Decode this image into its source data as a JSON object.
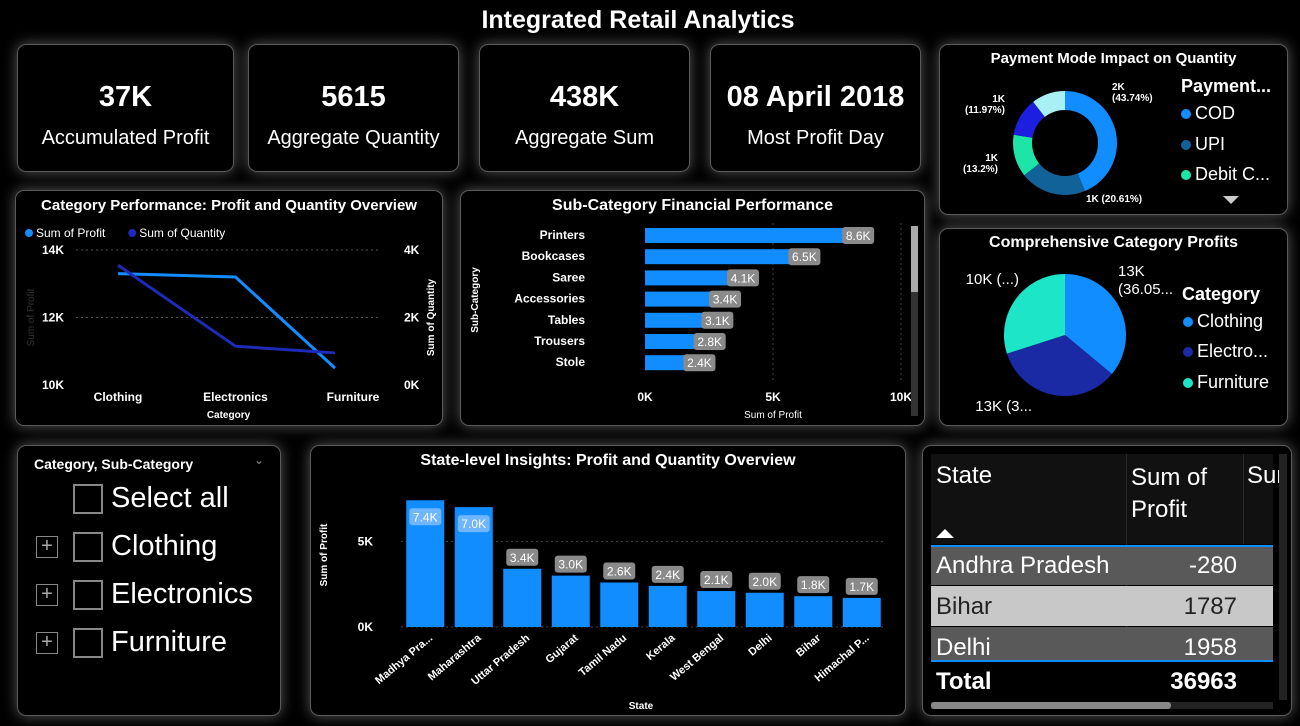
{
  "title": "Integrated Retail Analytics",
  "kpis": [
    {
      "value": "37K",
      "label": "Accumulated Profit"
    },
    {
      "value": "5615",
      "label": "Aggregate Quantity"
    },
    {
      "value": "438K",
      "label": "Aggregate Sum"
    },
    {
      "value": "08 April 2018",
      "label": "Most Profit Day"
    }
  ],
  "payment": {
    "title": "Payment Mode Impact on Quantity",
    "legend_title": "Payment...",
    "legend": [
      {
        "label": "COD",
        "color": "#118dff"
      },
      {
        "label": "UPI",
        "color": "#12629a"
      },
      {
        "label": "Debit C...",
        "color": "#1de5a8"
      }
    ]
  },
  "category_line": {
    "title": "Category Performance: Profit and Quantity Overview",
    "legend": [
      {
        "label": "Sum of Profit",
        "color": "#118dff"
      },
      {
        "label": "Sum of Quantity",
        "color": "#1e2bb8"
      }
    ]
  },
  "subcategory_bar": {
    "title": "Sub-Category Financial Performance"
  },
  "category_pie": {
    "title": "Comprehensive Category Profits",
    "legend_title": "Category",
    "legend": [
      {
        "label": "Clothing",
        "color": "#118dff"
      },
      {
        "label": "Electro...",
        "color": "#1a2aa5"
      },
      {
        "label": "Furniture",
        "color": "#1de5c8"
      }
    ]
  },
  "slicer": {
    "title": "Category, Sub-Category",
    "items": [
      "Select all",
      "Clothing",
      "Electronics",
      "Furniture"
    ]
  },
  "state_bar": {
    "title": "State-level Insights: Profit and Quantity Overview"
  },
  "table": {
    "headers": [
      "State",
      "Sum of Profit",
      "Sur"
    ],
    "rows": [
      {
        "state": "Andhra Pradesh",
        "profit": "-280"
      },
      {
        "state": "Bihar",
        "profit": "1787"
      },
      {
        "state": "Delhi",
        "profit": "1958"
      }
    ],
    "total_label": "Total",
    "total_value": "36963"
  },
  "chart_data": [
    {
      "type": "line",
      "title": "Category Performance: Profit and Quantity Overview",
      "xlabel": "Category",
      "ylabel": "Sum of Profit",
      "y2label": "Sum of Quantity",
      "categories": [
        "Clothing",
        "Electronics",
        "Furniture"
      ],
      "y_ticks": [
        "10K",
        "12K",
        "14K"
      ],
      "y2_ticks": [
        "0K",
        "2K",
        "4K"
      ],
      "ylim": [
        10000,
        14000
      ],
      "y2lim": [
        0,
        4000
      ],
      "series": [
        {
          "name": "Sum of Profit",
          "axis": "left",
          "values": [
            13300,
            13200,
            10500
          ],
          "color": "#118dff"
        },
        {
          "name": "Sum of Quantity",
          "axis": "right",
          "values": [
            3550,
            1150,
            950
          ],
          "color": "#1e2bb8"
        }
      ]
    },
    {
      "type": "bar",
      "orientation": "horizontal",
      "title": "Sub-Category Financial Performance",
      "xlabel": "Sum of Profit",
      "ylabel": "Sub-Category",
      "categories": [
        "Printers",
        "Bookcases",
        "Saree",
        "Accessories",
        "Tables",
        "Trousers",
        "Stole"
      ],
      "values": [
        8600,
        6500,
        4100,
        3400,
        3100,
        2800,
        2400
      ],
      "labels": [
        "8.6K",
        "6.5K",
        "4.1K",
        "3.4K",
        "3.1K",
        "2.8K",
        "2.4K"
      ],
      "x_ticks": [
        "0K",
        "5K",
        "10K"
      ],
      "xlim": [
        0,
        10000
      ],
      "color": "#118dff"
    },
    {
      "type": "pie",
      "subtype": "donut",
      "title": "Payment Mode Impact on Quantity",
      "slices": [
        {
          "label": "2K\n(43.74%)",
          "value": 43.74,
          "color": "#118dff"
        },
        {
          "label": "1K (20.61%)",
          "value": 20.61,
          "color": "#12629a"
        },
        {
          "label": "1K\n(13.2%)",
          "value": 13.2,
          "color": "#1de5a8"
        },
        {
          "label": "1K\n(11.97%)",
          "value": 11.97,
          "color": "#1c1fe0"
        },
        {
          "value": 10.48,
          "color": "#a9f0f5"
        }
      ]
    },
    {
      "type": "pie",
      "title": "Comprehensive Category Profits",
      "slices": [
        {
          "label": "13K\n(36.05...",
          "value": 36.05,
          "color": "#118dff"
        },
        {
          "label": "13K (3...",
          "value": 34.0,
          "color": "#1a2aa5"
        },
        {
          "label": "10K (...)",
          "value": 29.95,
          "color": "#1de5c8"
        }
      ]
    },
    {
      "type": "bar",
      "title": "State-level Insights: Profit and Quantity Overview",
      "xlabel": "State",
      "ylabel": "Sum of Profit",
      "categories": [
        "Madhya Pra...",
        "Maharashtra",
        "Uttar Pradesh",
        "Gujarat",
        "Tamil Nadu",
        "Kerala",
        "West Bengal",
        "Delhi",
        "Bihar",
        "Himachal P..."
      ],
      "values": [
        7400,
        7000,
        3400,
        3000,
        2600,
        2400,
        2100,
        2000,
        1800,
        1700
      ],
      "labels": [
        "7.4K",
        "7.0K",
        "3.4K",
        "3.0K",
        "2.6K",
        "2.4K",
        "2.1K",
        "2.0K",
        "1.8K",
        "1.7K"
      ],
      "y_ticks": [
        "0K",
        "5K"
      ],
      "ylim": [
        0,
        8000
      ],
      "color": "#118dff"
    }
  ]
}
